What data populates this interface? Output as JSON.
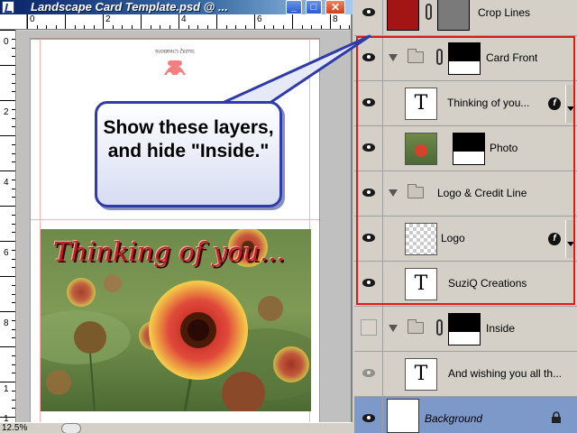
{
  "window": {
    "title": "Landscape Card Template.psd @ ...",
    "minimize_glyph": "_",
    "maximize_glyph": "□",
    "close_glyph": "✕"
  },
  "rulers": {
    "horizontal": [
      "0",
      "2",
      "4",
      "6",
      "8"
    ],
    "vertical": [
      "0",
      "2",
      "4",
      "6",
      "8",
      "1",
      "1"
    ]
  },
  "canvas": {
    "photo_caption": "Thinking of you...",
    "upside_down_credit": "SuziQ Creations"
  },
  "status": {
    "zoom": "12.5%"
  },
  "callout": {
    "text": "Show these layers, and hide \"Inside.\""
  },
  "layers": [
    {
      "label": "Crop Lines",
      "visible": true,
      "type": "color-fill"
    },
    {
      "label": "Card Front",
      "visible": true,
      "type": "group-with-mask"
    },
    {
      "label": "Thinking of you...",
      "visible": true,
      "type": "text",
      "has_effects": true
    },
    {
      "label": "Photo",
      "visible": true,
      "type": "image-with-mask"
    },
    {
      "label": "Logo & Credit Line",
      "visible": true,
      "type": "group"
    },
    {
      "label": "Logo",
      "visible": true,
      "type": "image",
      "has_effects": true
    },
    {
      "label": "SuziQ Creations",
      "visible": true,
      "type": "text"
    },
    {
      "label": "Inside",
      "visible": false,
      "type": "group-with-mask"
    },
    {
      "label": "And wishing you all th...",
      "visible": true,
      "type": "text"
    },
    {
      "label": "Background",
      "visible": true,
      "type": "background",
      "locked": true
    }
  ],
  "colors": {
    "highlight": "#e01818",
    "callout_border": "#2e3ba8",
    "crop_lines_swatch": "#a31515",
    "selected_layer": "#7d99c9"
  },
  "icons": {
    "visibility": "eye-icon",
    "group": "folder-icon",
    "expand": "triangle-icon",
    "link": "chain-icon",
    "effects": "fx-icon",
    "lock": "lock-icon"
  }
}
